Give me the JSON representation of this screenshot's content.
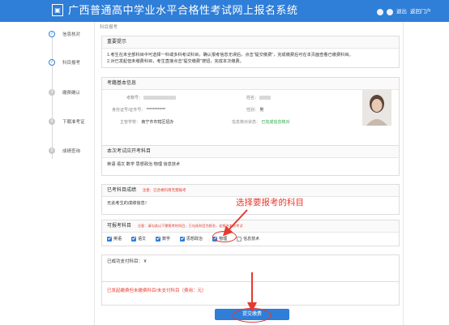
{
  "header": {
    "logo_text": "▣",
    "title": "广西普通高中学业水平合格性考试网上报名系统",
    "exit_label": "退出",
    "portal_label": "返回门户"
  },
  "steps": [
    {
      "num": "✓",
      "label": "信息核对",
      "done": true
    },
    {
      "num": "✓",
      "label": "科目报考",
      "done": true
    },
    {
      "num": "3",
      "label": "缴费确认",
      "done": false
    },
    {
      "num": "4",
      "label": "下载准考证",
      "done": false
    },
    {
      "num": "5",
      "label": "成绩查询",
      "done": false
    }
  ],
  "main": {
    "breadcrumb": "科目报考",
    "notice": {
      "title": "重要提示",
      "line1": "1.考生在未全部科目中可选择一科或多科考试科目，确认报考信息无误后，点击\"提交缴费\"，完成缴费后可在本页面查看已缴费科目。",
      "line2": "2.对已发起但未缴费科目，考生直接点击\"提交缴费\"按钮，完成本次缴费。"
    },
    "basic": {
      "title": "考籍基本信息",
      "exam_no_label": "考籍号：",
      "name_label": "姓名：",
      "id_label": "身份证号/证件号：",
      "id_value": "************",
      "gender_label": "性别：",
      "gender_value": "男",
      "school_label": "主管学校：",
      "school_value": "南宁市市辖区招办",
      "verify_label": "信息核对状态：",
      "verify_value": "已完成信息核对"
    },
    "offered": {
      "title": "本次考试应开考科目",
      "subjects": "英语 语文 数学 思想政治 物理 信息技术"
    },
    "passed": {
      "title": "已考科目成绩",
      "note": "注意：已合格科目无需报考",
      "body": "无此考生的成绩信息！"
    },
    "optional": {
      "title": "可报考科目",
      "note": "注意：请勾选以下需报考的科目，已勾选科目为报名，若报名本次考试",
      "items": [
        {
          "label": "英语",
          "checked": true
        },
        {
          "label": "语文",
          "checked": true
        },
        {
          "label": "数学",
          "checked": true
        },
        {
          "label": "思想政治",
          "checked": true
        },
        {
          "label": "物理",
          "checked": true
        },
        {
          "label": "信息技术",
          "checked": false
        }
      ]
    },
    "paid": {
      "title": "已成功支付科目：",
      "value": "¥"
    },
    "pending": {
      "text": "已发起缴费但未缴费科目/未支付科目（费用：元）"
    },
    "submit_label": "提交缴费"
  },
  "annotation": {
    "text": "选择要报考的科目",
    "color": "#e63a2e"
  },
  "colors": {
    "primary": "#2f7ed8",
    "accent": "#e63a2e",
    "success": "#29a745"
  }
}
